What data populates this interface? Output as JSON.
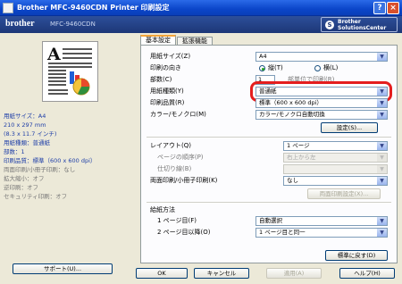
{
  "window": {
    "title": "Brother MFC-9460CDN Printer 印刷設定",
    "help_label": "?",
    "close_label": "×"
  },
  "header": {
    "brand": "brother",
    "model": "MFC-9460CDN",
    "solutions_line1": "Brother",
    "solutions_line2": "SolutionsCenter"
  },
  "summary": {
    "paper_size": "用紙サイズ：A4",
    "paper_dims_mm": "210 x 297 mm",
    "paper_dims_in": "(8.3 x 11.7 インチ)",
    "media_type": "用紙種類：普通紙",
    "copies": "部数：1",
    "quality": "印刷品質：標準（600 x 600 dpi）",
    "duplex": "両面印刷/小冊子印刷：なし",
    "scaling": "拡大縮小：オフ",
    "reverse": "逆印刷：オフ",
    "secure": "セキュリティ印刷：オフ"
  },
  "tabs": [
    {
      "label": "基本設定"
    },
    {
      "label": "拡張機能"
    }
  ],
  "form": {
    "paper_size": {
      "label": "用紙サイズ(Z)",
      "value": "A4"
    },
    "orientation": {
      "label": "印刷の向き",
      "portrait": "縦(T)",
      "landscape": "横(L)"
    },
    "copies": {
      "label": "部数(C)",
      "value": "1",
      "collate": "部単位で印刷(R)"
    },
    "media_type": {
      "label": "用紙種類(Y)",
      "value": "普通紙"
    },
    "resolution": {
      "label": "印刷品質(R)",
      "value": "標準（600 x 600 dpi）"
    },
    "color": {
      "label": "カラー/モノクロ(M)",
      "value": "カラー/モノクロ自動切換"
    },
    "settings_button": "設定(S)...",
    "layout": {
      "label": "レイアウト(Q)",
      "value": "1 ページ"
    },
    "page_order": {
      "label": "ページの順序(P)",
      "value": "右上から左"
    },
    "border": {
      "label": "仕切り線(B)",
      "value": ""
    },
    "duplex": {
      "label": "両面印刷/小冊子印刷(K)",
      "value": "なし"
    },
    "duplex_settings_button": "両面印刷設定(X)...",
    "source_section": "給紙方法",
    "first_page": {
      "label": "1 ページ目(F)",
      "value": "自動選択"
    },
    "other_pages": {
      "label": "2 ページ目以降(O)",
      "value": "1 ページ目と同一"
    },
    "defaults_button": "標準に戻す(D)"
  },
  "footer": {
    "support": "サポート(U)...",
    "ok": "OK",
    "cancel": "キャンセル",
    "apply": "適用(A)",
    "help": "ヘルプ(H)"
  },
  "colors": {
    "titlebar": "#0b45c9",
    "header": "#1d3777",
    "highlight": "#e41e1e"
  }
}
